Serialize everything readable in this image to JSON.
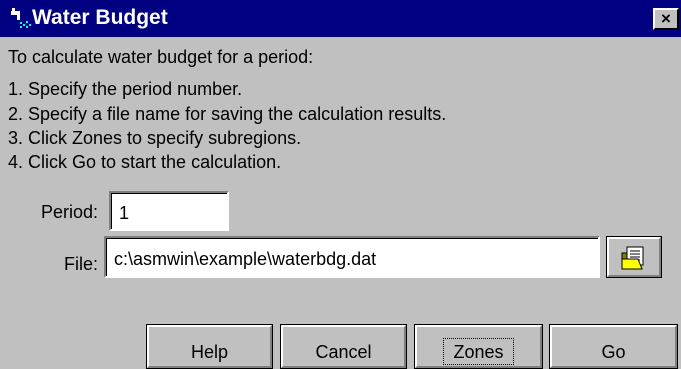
{
  "window": {
    "title": "Water Budget",
    "close_symbol": "×",
    "app_icon": "faucet-icon"
  },
  "instructions": [
    "To calculate water budget for a period:",
    "1. Specify the period number.",
    "2. Specify a file name for saving the calculation results.",
    "3. Click Zones to specify subregions.",
    "4. Click Go to start the calculation."
  ],
  "form": {
    "period_label": "Period:",
    "period_value": "1",
    "file_label": "File:",
    "file_value": "c:\\asmwin\\example\\waterbdg.dat",
    "browse_icon": "file-browse-icon"
  },
  "buttons": {
    "help": "Help",
    "cancel": "Cancel",
    "zones": "Zones",
    "go": "Go"
  },
  "colors": {
    "title_bar": "#000080",
    "dialog_face": "#c0c0c0"
  }
}
